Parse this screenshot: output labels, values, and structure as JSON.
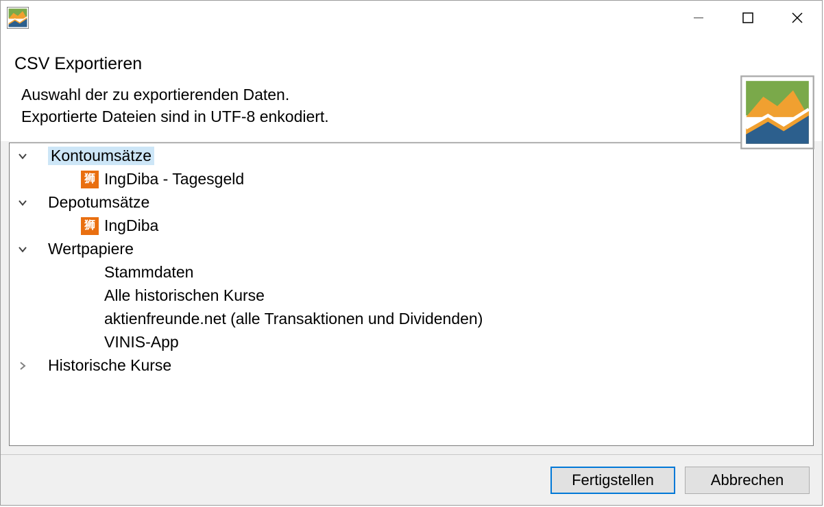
{
  "window": {
    "title": ""
  },
  "header": {
    "title": "CSV Exportieren",
    "line1": "Auswahl der zu exportierenden Daten.",
    "line2": "Exportierte Dateien sind in UTF-8 enkodiert."
  },
  "tree": {
    "nodes": [
      {
        "label": "Kontoumsätze",
        "level": 0,
        "expanded": true,
        "hasChildren": true,
        "selected": true,
        "icon": null
      },
      {
        "label": "IngDiba - Tagesgeld",
        "level": 1,
        "expanded": false,
        "hasChildren": false,
        "selected": false,
        "icon": "ing"
      },
      {
        "label": "Depotumsätze",
        "level": 0,
        "expanded": true,
        "hasChildren": true,
        "selected": false,
        "icon": null
      },
      {
        "label": "IngDiba",
        "level": 1,
        "expanded": false,
        "hasChildren": false,
        "selected": false,
        "icon": "ing"
      },
      {
        "label": "Wertpapiere",
        "level": 0,
        "expanded": true,
        "hasChildren": true,
        "selected": false,
        "icon": null
      },
      {
        "label": "Stammdaten",
        "level": 1,
        "expanded": false,
        "hasChildren": false,
        "selected": false,
        "icon": null
      },
      {
        "label": "Alle historischen Kurse",
        "level": 1,
        "expanded": false,
        "hasChildren": false,
        "selected": false,
        "icon": null
      },
      {
        "label": "aktienfreunde.net (alle Transaktionen und Dividenden)",
        "level": 1,
        "expanded": false,
        "hasChildren": false,
        "selected": false,
        "icon": null
      },
      {
        "label": "VINIS-App",
        "level": 1,
        "expanded": false,
        "hasChildren": false,
        "selected": false,
        "icon": null
      },
      {
        "label": "Historische Kurse",
        "level": 0,
        "expanded": false,
        "hasChildren": true,
        "selected": false,
        "icon": null
      }
    ]
  },
  "buttons": {
    "finish": "Fertigstellen",
    "cancel": "Abbrechen"
  }
}
